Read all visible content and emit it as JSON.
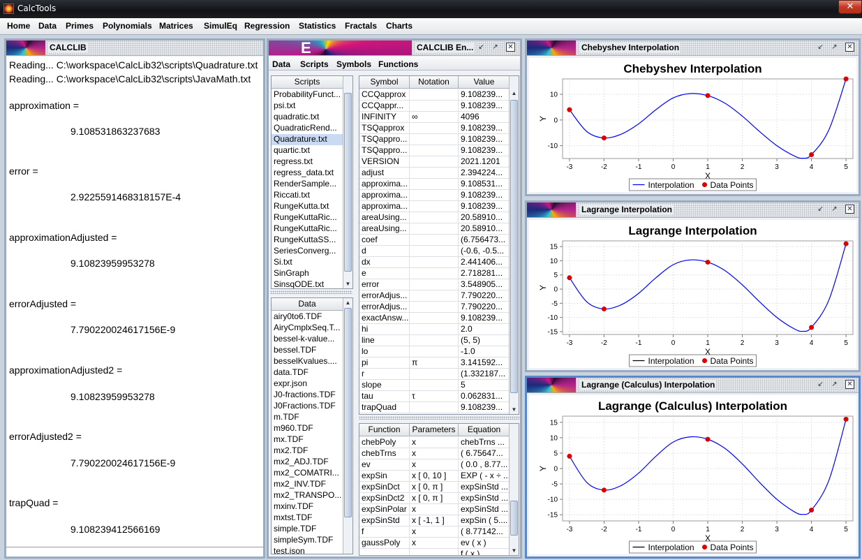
{
  "window": {
    "title": "CalcTools",
    "close_glyph": "✕"
  },
  "menu": [
    "Home",
    "Data",
    "Primes",
    "Polynomials",
    "Matrices",
    "SimulEq",
    "Regression",
    "Statistics",
    "Fractals",
    "Charts"
  ],
  "console": {
    "title": "CALCLIB",
    "lines": [
      {
        "text": "Reading... C:\\workspace\\CalcLib32\\scripts\\Quadrature.txt",
        "indent": false
      },
      {
        "text": "Reading... C:\\workspace\\CalcLib32\\scripts\\JavaMath.txt",
        "indent": false
      },
      {
        "text": "approximation =",
        "indent": false
      },
      {
        "text": "9.108531863237683",
        "indent": true
      },
      {
        "text": "error =",
        "indent": false
      },
      {
        "text": "2.9225591468318157E-4",
        "indent": true
      },
      {
        "text": "approximationAdjusted =",
        "indent": false
      },
      {
        "text": "9.10823959953278",
        "indent": true
      },
      {
        "text": "errorAdjusted =",
        "indent": false
      },
      {
        "text": "7.790220024617156E-9",
        "indent": true
      },
      {
        "text": "approximationAdjusted2 =",
        "indent": false
      },
      {
        "text": "9.10823959953278",
        "indent": true
      },
      {
        "text": "errorAdjusted2 =",
        "indent": false
      },
      {
        "text": "7.790220024617156E-9",
        "indent": true
      },
      {
        "text": "trapQuad =",
        "indent": false
      },
      {
        "text": "9.108239412566169",
        "indent": true
      }
    ]
  },
  "env": {
    "title": "CALCLIB En...",
    "menu": [
      "Data",
      "Scripts",
      "Symbols",
      "Functions"
    ],
    "scripts_header": "Scripts",
    "scripts": [
      "ProbabilityFunct...",
      "psi.txt",
      "quadratic.txt",
      "QuadraticRend...",
      "Quadrature.txt",
      "quartic.txt",
      "regress.txt",
      "regress_data.txt",
      "RenderSample...",
      "Riccati.txt",
      "RungeKutta.txt",
      "RungeKuttaRic...",
      "RungeKuttaRic...",
      "RungeKuttaSS...",
      "SeriesConverg...",
      "Si.txt",
      "SinGraph",
      "SinsqODE.txt"
    ],
    "scripts_selected": 4,
    "data_header": "Data",
    "data": [
      "airy0to6.TDF",
      "AiryCmplxSeq.T...",
      "bessel-k-value...",
      "bessel.TDF",
      "besselKvalues....",
      "data.TDF",
      "expr.json",
      "J0-fractions.TDF",
      "J0Fractions.TDF",
      "m.TDF",
      "m960.TDF",
      "mx.TDF",
      "mx2.TDF",
      "mx2_ADJ.TDF",
      "mx2_COMATRI...",
      "mx2_INV.TDF",
      "mx2_TRANSPO...",
      "mxinv.TDF",
      "mxtst.TDF",
      "simple.TDF",
      "simpleSym.TDF",
      "test.json"
    ],
    "symbols_headers": [
      "Symbol",
      "Notation",
      "Value"
    ],
    "symbols": [
      [
        "CCQapprox",
        "",
        "9.108239..."
      ],
      [
        "CCQappr...",
        "",
        "9.108239..."
      ],
      [
        "INFINITY",
        "∞",
        "4096"
      ],
      [
        "TSQapprox",
        "",
        "9.108239..."
      ],
      [
        "TSQappro...",
        "",
        "9.108239..."
      ],
      [
        "TSQappro...",
        "",
        "9.108239..."
      ],
      [
        "VERSION",
        "",
        "2021.1201"
      ],
      [
        "adjust",
        "",
        "2.394224..."
      ],
      [
        "approxima...",
        "",
        "9.108531..."
      ],
      [
        "approxima...",
        "",
        "9.108239..."
      ],
      [
        "approxima...",
        "",
        "9.108239..."
      ],
      [
        "areaUsing...",
        "",
        "20.58910..."
      ],
      [
        "areaUsing...",
        "",
        "20.58910..."
      ],
      [
        "coef",
        "",
        "(6.756473..."
      ],
      [
        "d",
        "",
        "(-0.6, -0.5..."
      ],
      [
        "dx",
        "",
        "2.441406..."
      ],
      [
        "e",
        "",
        "2.718281..."
      ],
      [
        "error",
        "",
        "3.548905..."
      ],
      [
        "errorAdjus...",
        "",
        "7.790220..."
      ],
      [
        "errorAdjus...",
        "",
        "7.790220..."
      ],
      [
        "exactAnsw...",
        "",
        "9.108239..."
      ],
      [
        "hi",
        "",
        "2.0"
      ],
      [
        "line",
        "",
        "(5, 5)"
      ],
      [
        "lo",
        "",
        "-1.0"
      ],
      [
        "pi",
        "π",
        "3.141592..."
      ],
      [
        "r",
        "",
        "(1.332187..."
      ],
      [
        "slope",
        "",
        "5"
      ],
      [
        "tau",
        "τ",
        "0.062831..."
      ],
      [
        "trapQuad",
        "",
        "9.108239..."
      ]
    ],
    "functions_headers": [
      "Function",
      "Parameters",
      "Equation"
    ],
    "functions": [
      [
        "chebPoly",
        "x",
        "chebTrns ..."
      ],
      [
        "chebTrns",
        "x",
        "( 6.75647..."
      ],
      [
        "ev",
        "x",
        "( 0.0 , 8.77..."
      ],
      [
        "expSin",
        "x [ 0, 10 ]",
        "EXP ( - x ÷ ..."
      ],
      [
        "expSinDct",
        "x [ 0, π ]",
        "expSinStd ..."
      ],
      [
        "expSinDct2",
        "x [ 0, π ]",
        "expSinStd ..."
      ],
      [
        "expSinPolar",
        "x",
        "expSinStd ..."
      ],
      [
        "expSinStd",
        "x [ -1, 1 ]",
        "expSin ( 5...."
      ],
      [
        "f",
        "x",
        "( 8.77142..."
      ],
      [
        "gaussPoly",
        "x",
        "ev ( x )"
      ],
      [
        "",
        "",
        "f ( x )"
      ]
    ]
  },
  "charts": [
    {
      "frame_title": "Chebyshev Interpolation",
      "chart_data": {
        "type": "line",
        "title": "Chebyshev Interpolation",
        "xlabel": "X",
        "ylabel": "Y",
        "xlim": [
          -3.2,
          5.2
        ],
        "ylim": [
          -15,
          16
        ],
        "xticks": [
          -3,
          -2,
          -1,
          0,
          1,
          2,
          3,
          4,
          5
        ],
        "yticks": [
          -10,
          0,
          10
        ],
        "series": [
          {
            "name": "Interpolation",
            "kind": "line",
            "color": "#0000ff",
            "points": [
              [
                -3,
                4
              ],
              [
                -2.5,
                -4.5
              ],
              [
                -2,
                -7
              ],
              [
                -1.5,
                -5.5
              ],
              [
                -1,
                -1.5
              ],
              [
                -0.5,
                4
              ],
              [
                0,
                8.6
              ],
              [
                0.5,
                10.3
              ],
              [
                1,
                9.5
              ],
              [
                1.5,
                6.5
              ],
              [
                2,
                1.5
              ],
              [
                2.5,
                -4.5
              ],
              [
                3,
                -10
              ],
              [
                3.5,
                -14
              ],
              [
                3.75,
                -14.9
              ],
              [
                4,
                -13.5
              ],
              [
                4.5,
                -4
              ],
              [
                5,
                16
              ]
            ]
          },
          {
            "name": "Data Points",
            "kind": "scatter",
            "color": "#dd0000",
            "points": [
              [
                -3,
                4
              ],
              [
                -2,
                -7
              ],
              [
                1,
                9.5
              ],
              [
                4,
                -13.5
              ],
              [
                5,
                16
              ]
            ]
          }
        ],
        "legend": "bottom"
      }
    },
    {
      "frame_title": "Lagrange Interpolation",
      "chart_data": {
        "type": "line",
        "title": "Lagrange Interpolation",
        "xlabel": "X",
        "ylabel": "Y",
        "xlim": [
          -3.2,
          5.2
        ],
        "ylim": [
          -16,
          17
        ],
        "xticks": [
          -3,
          -2,
          -1,
          0,
          1,
          2,
          3,
          4,
          5
        ],
        "yticks": [
          -15,
          -10,
          -5,
          0,
          5,
          10,
          15
        ],
        "series": [
          {
            "name": "Interpolation",
            "kind": "line",
            "color": "#0000ff",
            "points": [
              [
                -3,
                4
              ],
              [
                -2.5,
                -4.5
              ],
              [
                -2,
                -7
              ],
              [
                -1.5,
                -5.5
              ],
              [
                -1,
                -1.5
              ],
              [
                -0.5,
                4
              ],
              [
                0,
                8.6
              ],
              [
                0.5,
                10.3
              ],
              [
                1,
                9.5
              ],
              [
                1.5,
                6.5
              ],
              [
                2,
                1.5
              ],
              [
                2.5,
                -4.5
              ],
              [
                3,
                -10
              ],
              [
                3.5,
                -14
              ],
              [
                3.75,
                -14.9
              ],
              [
                4,
                -13.5
              ],
              [
                4.5,
                -4
              ],
              [
                5,
                16
              ]
            ]
          },
          {
            "name": "Data Points",
            "kind": "scatter",
            "color": "#dd0000",
            "points": [
              [
                -3,
                4
              ],
              [
                -2,
                -7
              ],
              [
                1,
                9.5
              ],
              [
                4,
                -13.5
              ],
              [
                5,
                16
              ]
            ]
          }
        ],
        "legend": "bottom"
      }
    },
    {
      "frame_title": "Lagrange (Calculus) Interpolation",
      "chart_data": {
        "type": "line",
        "title": "Lagrange (Calculus) Interpolation",
        "xlabel": "X",
        "ylabel": "Y",
        "xlim": [
          -3.2,
          5.2
        ],
        "ylim": [
          -17,
          17
        ],
        "xticks": [
          -3,
          -2,
          -1,
          0,
          1,
          2,
          3,
          4,
          5
        ],
        "yticks": [
          -15,
          -10,
          -5,
          0,
          5,
          10,
          15
        ],
        "series": [
          {
            "name": "Interpolation",
            "kind": "line",
            "color": "#0000ff",
            "points": [
              [
                -3,
                4
              ],
              [
                -2.5,
                -4.5
              ],
              [
                -2,
                -7
              ],
              [
                -1.5,
                -5.5
              ],
              [
                -1,
                -1.5
              ],
              [
                -0.5,
                4
              ],
              [
                0,
                8.6
              ],
              [
                0.5,
                10.3
              ],
              [
                1,
                9.5
              ],
              [
                1.5,
                6.5
              ],
              [
                2,
                1.5
              ],
              [
                2.5,
                -4.5
              ],
              [
                3,
                -10
              ],
              [
                3.5,
                -14
              ],
              [
                3.75,
                -14.9
              ],
              [
                4,
                -13.5
              ],
              [
                4.5,
                -4
              ],
              [
                5,
                16
              ]
            ]
          },
          {
            "name": "Data Points",
            "kind": "scatter",
            "color": "#dd0000",
            "points": [
              [
                -3,
                4
              ],
              [
                -2,
                -7
              ],
              [
                1,
                9.5
              ],
              [
                4,
                -13.5
              ],
              [
                5,
                16
              ]
            ]
          }
        ],
        "legend": "bottom"
      }
    }
  ],
  "frame_controls": {
    "restore": "↙",
    "maximize": "↗",
    "close": "✕"
  },
  "scroll_glyphs": {
    "up": "▲",
    "down": "▼"
  }
}
